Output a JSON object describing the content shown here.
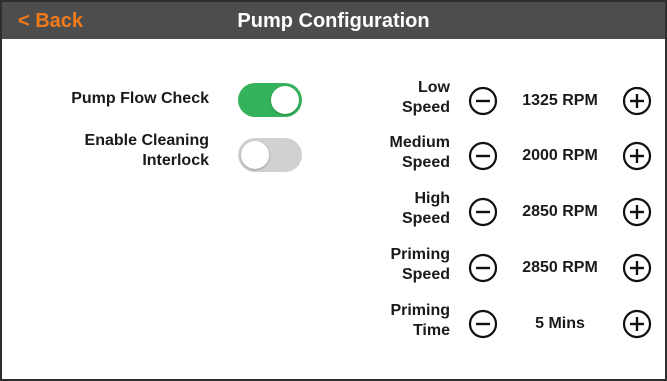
{
  "header": {
    "back_label": "< Back",
    "title": "Pump Configuration"
  },
  "settings": [
    {
      "label": "Pump Flow Check",
      "state": "on"
    },
    {
      "label_line1": "Enable Cleaning",
      "label_line2": "Interlock",
      "state": "off"
    }
  ],
  "speeds": [
    {
      "label_line1": "Low",
      "label_line2": "Speed",
      "value": "1325 RPM"
    },
    {
      "label_line1": "Medium",
      "label_line2": "Speed",
      "value": "2000 RPM"
    },
    {
      "label_line1": "High",
      "label_line2": "Speed",
      "value": "2850 RPM"
    },
    {
      "label_line1": "Priming",
      "label_line2": "Speed",
      "value": "2850 RPM"
    },
    {
      "label_line1": "Priming",
      "label_line2": "Time",
      "value": "5 Mins"
    }
  ],
  "icons": {
    "minus": "minus-circle-icon",
    "plus": "plus-circle-icon"
  },
  "colors": {
    "header_bg": "#4d4d4d",
    "back_text": "#f27a1a",
    "toggle_on": "#35b25c",
    "toggle_off": "#d1d1d1"
  }
}
